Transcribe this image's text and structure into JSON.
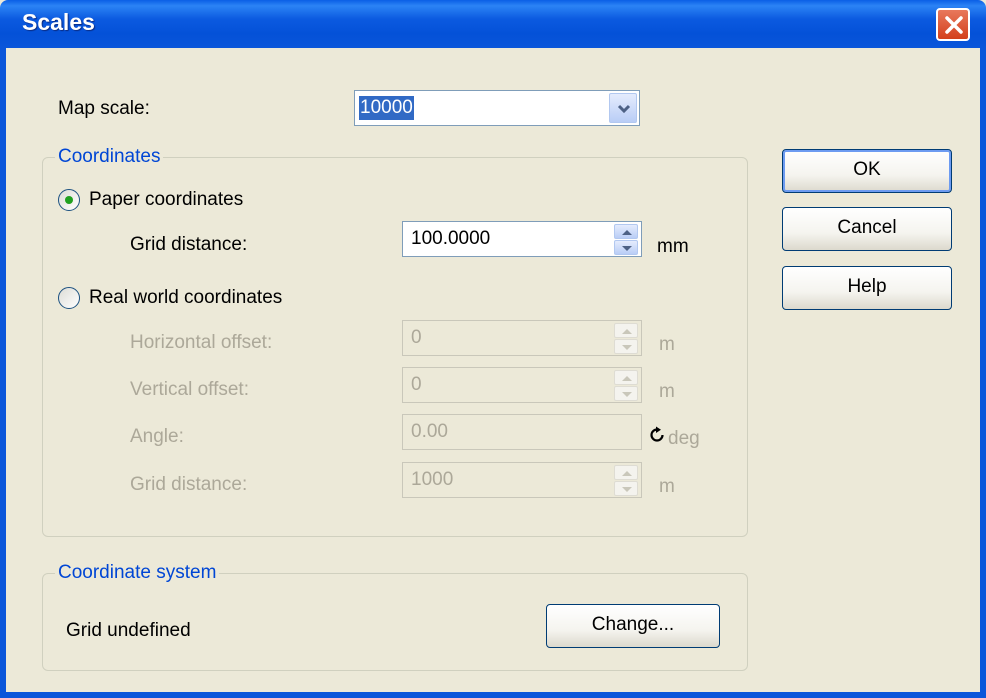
{
  "window": {
    "title": "Scales"
  },
  "map_scale": {
    "label": "Map scale:",
    "value": "10000"
  },
  "coordinates": {
    "group_label": "Coordinates",
    "paper": {
      "label": "Paper coordinates",
      "selected": true,
      "grid_distance": {
        "label": "Grid distance:",
        "value": "100.0000",
        "unit": "mm"
      }
    },
    "real_world": {
      "label": "Real world coordinates",
      "selected": false,
      "horizontal_offset": {
        "label": "Horizontal offset:",
        "value": "0",
        "unit": "m"
      },
      "vertical_offset": {
        "label": "Vertical offset:",
        "value": "0",
        "unit": "m"
      },
      "angle": {
        "label": "Angle:",
        "value": "0.00",
        "unit": "deg"
      },
      "grid_distance": {
        "label": "Grid distance:",
        "value": "1000",
        "unit": "m"
      }
    }
  },
  "coordinate_system": {
    "group_label": "Coordinate system",
    "status": "Grid undefined",
    "change_button": "Change..."
  },
  "buttons": {
    "ok": "OK",
    "cancel": "Cancel",
    "help": "Help"
  },
  "colors": {
    "title_bar": "#0a56da",
    "dialog_bg": "#ece9d8",
    "group_label": "#0046d5",
    "selection": "#316ac5",
    "disabled_text": "#aca899"
  }
}
